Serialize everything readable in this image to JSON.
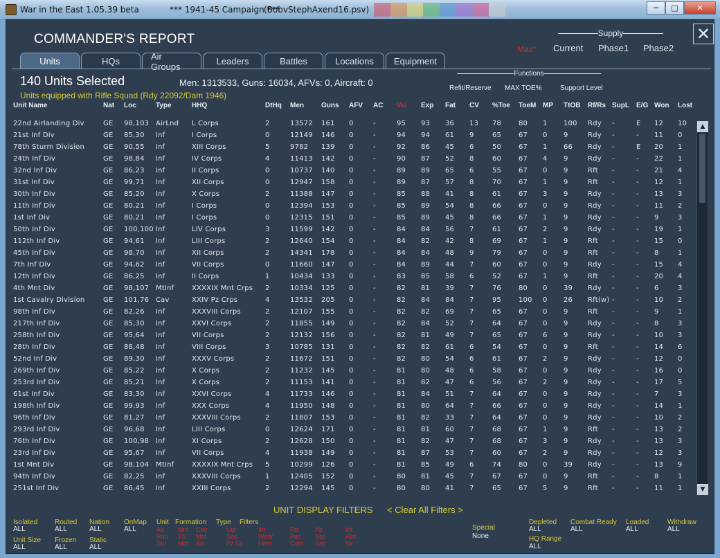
{
  "window": {
    "app_title": "War in the East 1.05.39 beta",
    "campaign": "***   1941-45 Campaign   ***",
    "save_file": "(BobvStephAxend16.psv)"
  },
  "report": {
    "title": "COMMANDER'S REPORT",
    "close": "✕"
  },
  "supply": {
    "label": "Supply",
    "mode": "Max*",
    "columns": [
      "Current",
      "Phase1",
      "Phase2"
    ]
  },
  "tabs": [
    "Units",
    "HQs",
    "Air Groups",
    "Leaders",
    "Battles",
    "Locations",
    "Equipment"
  ],
  "active_tab": "Units",
  "summary": {
    "units_selected": "140 Units Selected",
    "totals": "Men: 1313533, Guns: 16034, AFVs: 0, Aircraft: 0",
    "equipment_filter": "Units equipped with Rifle Squad (Rdy 22092/Dam 1946)"
  },
  "functions": {
    "label": "Functions",
    "items": [
      "Refit/Reserve",
      "MAX TOE%",
      "Support Level"
    ]
  },
  "columns": [
    "Unit Name",
    "Nat",
    "Loc",
    "Type",
    "HHQ",
    "DtHq",
    "Men",
    "Guns",
    "AFV",
    "AC",
    "Val",
    "Exp",
    "Fat",
    "CV",
    "%Toe",
    "ToeM",
    "MP",
    "TtOB",
    "Rf/Rs",
    "SupL",
    "E/G",
    "Won",
    "Lost"
  ],
  "rows": [
    [
      "22nd Airlanding Div",
      "GE",
      "98,103",
      "AirLnd",
      "L Corps",
      "2",
      "13572",
      "161",
      "0",
      "-",
      "95",
      "93",
      "36",
      "13",
      "78",
      "80",
      "1",
      "100",
      "Rdy",
      "-",
      "E",
      "12",
      "10"
    ],
    [
      "21st Inf Div",
      "GE",
      "85,30",
      "Inf",
      "I Corps",
      "0",
      "12149",
      "146",
      "0",
      "-",
      "94",
      "94",
      "61",
      "9",
      "65",
      "67",
      "0",
      "9",
      "Rdy",
      "-",
      "-",
      "11",
      "0"
    ],
    [
      "78th Sturm Division",
      "GE",
      "90,55",
      "Inf",
      "XIII Corps",
      "5",
      "9782",
      "139",
      "0",
      "-",
      "92",
      "86",
      "45",
      "6",
      "50",
      "67",
      "1",
      "66",
      "Rdy",
      "-",
      "E",
      "20",
      "1"
    ],
    [
      "24th Inf Div",
      "GE",
      "98,84",
      "Inf",
      "IV Corps",
      "4",
      "11413",
      "142",
      "0",
      "-",
      "90",
      "87",
      "52",
      "8",
      "60",
      "67",
      "4",
      "9",
      "Rdy",
      "-",
      "-",
      "22",
      "1"
    ],
    [
      "32nd Inf Div",
      "GE",
      "86,23",
      "Inf",
      "II Corps",
      "0",
      "10737",
      "140",
      "0",
      "-",
      "89",
      "89",
      "65",
      "6",
      "55",
      "67",
      "0",
      "9",
      "Rft",
      "-",
      "-",
      "21",
      "4"
    ],
    [
      "31st Inf Div",
      "GE",
      "99,71",
      "Inf",
      "XII Corps",
      "0",
      "12947",
      "158",
      "0",
      "-",
      "89",
      "87",
      "57",
      "8",
      "70",
      "67",
      "1",
      "9",
      "Rft",
      "-",
      "-",
      "12",
      "1"
    ],
    [
      "30th Inf Div",
      "GE",
      "85,20",
      "Inf",
      "X Corps",
      "2",
      "11388",
      "147",
      "0",
      "-",
      "85",
      "88",
      "41",
      "8",
      "61",
      "67",
      "3",
      "9",
      "Rdy",
      "-",
      "-",
      "13",
      "3"
    ],
    [
      "11th Inf Div",
      "GE",
      "80,21",
      "Inf",
      "I Corps",
      "0",
      "12394",
      "153",
      "0",
      "-",
      "85",
      "89",
      "54",
      "8",
      "66",
      "67",
      "0",
      "9",
      "Rdy",
      "-",
      "-",
      "11",
      "2"
    ],
    [
      "1st Inf Div",
      "GE",
      "80,21",
      "Inf",
      "I Corps",
      "0",
      "12315",
      "151",
      "0",
      "-",
      "85",
      "89",
      "45",
      "8",
      "66",
      "67",
      "1",
      "9",
      "Rdy",
      "-",
      "-",
      "9",
      "3"
    ],
    [
      "50th Inf Div",
      "GE",
      "100,100",
      "Inf",
      "LIV Corps",
      "3",
      "11599",
      "142",
      "0",
      "-",
      "84",
      "84",
      "56",
      "7",
      "61",
      "67",
      "2",
      "9",
      "Rdy",
      "-",
      "-",
      "19",
      "1"
    ],
    [
      "112th Inf Div",
      "GE",
      "94,61",
      "Inf",
      "LIII Corps",
      "2",
      "12640",
      "154",
      "0",
      "-",
      "84",
      "82",
      "42",
      "8",
      "69",
      "67",
      "1",
      "9",
      "Rft",
      "-",
      "-",
      "15",
      "0"
    ],
    [
      "45th Inf Div",
      "GE",
      "98,70",
      "Inf",
      "XII Corps",
      "2",
      "14341",
      "178",
      "0",
      "-",
      "84",
      "84",
      "48",
      "9",
      "79",
      "67",
      "0",
      "9",
      "Rft",
      "-",
      "-",
      "8",
      "1"
    ],
    [
      "7th Inf Div",
      "GE",
      "94,62",
      "Inf",
      "VII Corps",
      "0",
      "11660",
      "147",
      "0",
      "-",
      "84",
      "89",
      "44",
      "7",
      "60",
      "67",
      "0",
      "9",
      "Rdy",
      "-",
      "-",
      "15",
      "4"
    ],
    [
      "12th Inf Div",
      "GE",
      "86,25",
      "Inf",
      "II Corps",
      "1",
      "10434",
      "133",
      "0",
      "-",
      "83",
      "85",
      "58",
      "6",
      "52",
      "67",
      "1",
      "9",
      "Rft",
      "-",
      "-",
      "20",
      "4"
    ],
    [
      "4th Mnt Div",
      "GE",
      "98,107",
      "MtInf",
      "XXXXIX Mnt Crps",
      "2",
      "10334",
      "125",
      "0",
      "-",
      "82",
      "81",
      "39",
      "7",
      "76",
      "80",
      "0",
      "39",
      "Rdy",
      "-",
      "-",
      "6",
      "3"
    ],
    [
      "1st Cavalry Division",
      "GE",
      "101,76",
      "Cav",
      "XXIV Pz Crps",
      "4",
      "13532",
      "205",
      "0",
      "-",
      "82",
      "84",
      "84",
      "7",
      "95",
      "100",
      "0",
      "26",
      "Rft(w)",
      "-",
      "-",
      "10",
      "2"
    ],
    [
      "98th Inf Div",
      "GE",
      "82,26",
      "Inf",
      "XXXVIII Corps",
      "2",
      "12107",
      "155",
      "0",
      "-",
      "82",
      "82",
      "69",
      "7",
      "65",
      "67",
      "0",
      "9",
      "Rft",
      "-",
      "-",
      "9",
      "1"
    ],
    [
      "217th Inf Div",
      "GE",
      "85,30",
      "Inf",
      "XXVI Corps",
      "2",
      "11855",
      "149",
      "0",
      "-",
      "82",
      "84",
      "52",
      "7",
      "64",
      "67",
      "0",
      "9",
      "Rdy",
      "-",
      "-",
      "8",
      "3"
    ],
    [
      "258th Inf Div",
      "GE",
      "95,64",
      "Inf",
      "VII Corps",
      "2",
      "12132",
      "156",
      "0",
      "-",
      "82",
      "81",
      "49",
      "7",
      "65",
      "67",
      "6",
      "9",
      "Rdy",
      "-",
      "-",
      "10",
      "3"
    ],
    [
      "28th Inf Div",
      "GE",
      "88,48",
      "Inf",
      "VIII Corps",
      "3",
      "10785",
      "131",
      "0",
      "-",
      "82",
      "82",
      "61",
      "6",
      "54",
      "67",
      "0",
      "9",
      "Rft",
      "-",
      "-",
      "14",
      "6"
    ],
    [
      "52nd Inf Div",
      "GE",
      "89,30",
      "Inf",
      "XXXV Corps",
      "2",
      "11672",
      "151",
      "0",
      "-",
      "82",
      "80",
      "54",
      "6",
      "61",
      "67",
      "2",
      "9",
      "Rdy",
      "-",
      "-",
      "12",
      "0"
    ],
    [
      "269th Inf Div",
      "GE",
      "85,22",
      "Inf",
      "X Corps",
      "2",
      "11232",
      "145",
      "0",
      "-",
      "81",
      "80",
      "48",
      "6",
      "58",
      "67",
      "0",
      "9",
      "Rdy",
      "-",
      "-",
      "16",
      "0"
    ],
    [
      "253rd Inf Div",
      "GE",
      "85,21",
      "Inf",
      "X Corps",
      "2",
      "11153",
      "141",
      "0",
      "-",
      "81",
      "82",
      "47",
      "6",
      "56",
      "67",
      "2",
      "9",
      "Rdy",
      "-",
      "-",
      "17",
      "5"
    ],
    [
      "61st Inf Div",
      "GE",
      "83,30",
      "Inf",
      "XXVI Corps",
      "4",
      "11733",
      "146",
      "0",
      "-",
      "81",
      "84",
      "51",
      "7",
      "64",
      "67",
      "0",
      "9",
      "Rdy",
      "-",
      "-",
      "7",
      "3"
    ],
    [
      "198th Inf Div",
      "GE",
      "99,93",
      "Inf",
      "XXX Corps",
      "4",
      "11950",
      "148",
      "0",
      "-",
      "81",
      "80",
      "64",
      "7",
      "66",
      "67",
      "0",
      "9",
      "Rdy",
      "-",
      "-",
      "14",
      "1"
    ],
    [
      "96th Inf Div",
      "GE",
      "81,27",
      "Inf",
      "XXXVIII Corps",
      "2",
      "11807",
      "153",
      "0",
      "-",
      "81",
      "82",
      "33",
      "7",
      "64",
      "67",
      "0",
      "9",
      "Rdy",
      "-",
      "-",
      "10",
      "2"
    ],
    [
      "293rd Inf Div",
      "GE",
      "96,68",
      "Inf",
      "LIII Corps",
      "0",
      "12624",
      "171",
      "0",
      "-",
      "81",
      "81",
      "60",
      "7",
      "68",
      "67",
      "1",
      "9",
      "Rft",
      "-",
      "-",
      "13",
      "2"
    ],
    [
      "76th Inf Div",
      "GE",
      "100,98",
      "Inf",
      "XI Corps",
      "2",
      "12628",
      "150",
      "0",
      "-",
      "81",
      "82",
      "47",
      "7",
      "68",
      "67",
      "3",
      "9",
      "Rdy",
      "-",
      "-",
      "13",
      "3"
    ],
    [
      "23rd Inf Div",
      "GE",
      "95,67",
      "Inf",
      "VII Corps",
      "4",
      "11938",
      "149",
      "0",
      "-",
      "81",
      "87",
      "53",
      "7",
      "60",
      "67",
      "2",
      "9",
      "Rdy",
      "-",
      "-",
      "12",
      "3"
    ],
    [
      "1st Mnt Div",
      "GE",
      "98,104",
      "MtInf",
      "XXXXIX Mnt Crps",
      "5",
      "10299",
      "126",
      "0",
      "-",
      "81",
      "85",
      "49",
      "6",
      "74",
      "80",
      "0",
      "39",
      "Rdy",
      "-",
      "-",
      "13",
      "9"
    ],
    [
      "94th Inf Div",
      "GE",
      "82,25",
      "Inf",
      "XXXVIII Corps",
      "1",
      "12405",
      "152",
      "0",
      "-",
      "80",
      "81",
      "45",
      "7",
      "67",
      "67",
      "0",
      "9",
      "Rft",
      "-",
      "-",
      "8",
      "1"
    ],
    [
      "251st Inf Div",
      "GE",
      "86,45",
      "Inf",
      "XXIII Corps",
      "2",
      "12294",
      "145",
      "0",
      "-",
      "80",
      "80",
      "41",
      "7",
      "65",
      "67",
      "5",
      "9",
      "Rft",
      "-",
      "-",
      "11",
      "1"
    ]
  ],
  "filters": {
    "title": "UNIT DISPLAY FILTERS",
    "clear": "< Clear All Filters >",
    "groups": [
      {
        "label": "Isolated",
        "value": "ALL"
      },
      {
        "label": "Routed",
        "value": "ALL"
      },
      {
        "label": "Nation",
        "value": "ALL"
      },
      {
        "label": "OnMap",
        "value": "ALL"
      },
      {
        "label": "Unit Size",
        "value": "ALL"
      },
      {
        "label": "Frozen",
        "value": "ALL"
      },
      {
        "label": "Static",
        "value": "ALL"
      },
      {
        "label": "Depleted",
        "value": "ALL"
      },
      {
        "label": "Combat Ready",
        "value": "ALL"
      },
      {
        "label": "Loaded",
        "value": "ALL"
      },
      {
        "label": "Withdraw",
        "value": "ALL"
      },
      {
        "label": "HQ Range",
        "value": "ALL"
      }
    ],
    "filter_headers": [
      "Unit",
      "Formation",
      "Type",
      "Filters"
    ],
    "filter_red_cols": [
      [
        "Alt",
        "Ron",
        "Stu"
      ],
      [
        "Mnt",
        "SS",
        "Mot"
      ],
      [
        "Cav",
        "Mot",
        "Art"
      ],
      [
        "Ugt",
        "Sec.",
        "Pz Gr"
      ],
      [
        "Inf",
        "Wehr",
        "Heer"
      ],
      [
        "Fst",
        "Pan",
        "Com"
      ],
      [
        "Alt",
        "Sec",
        "Sec"
      ],
      [
        "Int",
        "Alld",
        "Sk"
      ]
    ],
    "special_label": "Special",
    "special_value": "None"
  },
  "colors": {
    "panel_bg": "#2f3e4f",
    "accent_yellow": "#d6c93a",
    "alert_red": "#cc2a2a"
  }
}
